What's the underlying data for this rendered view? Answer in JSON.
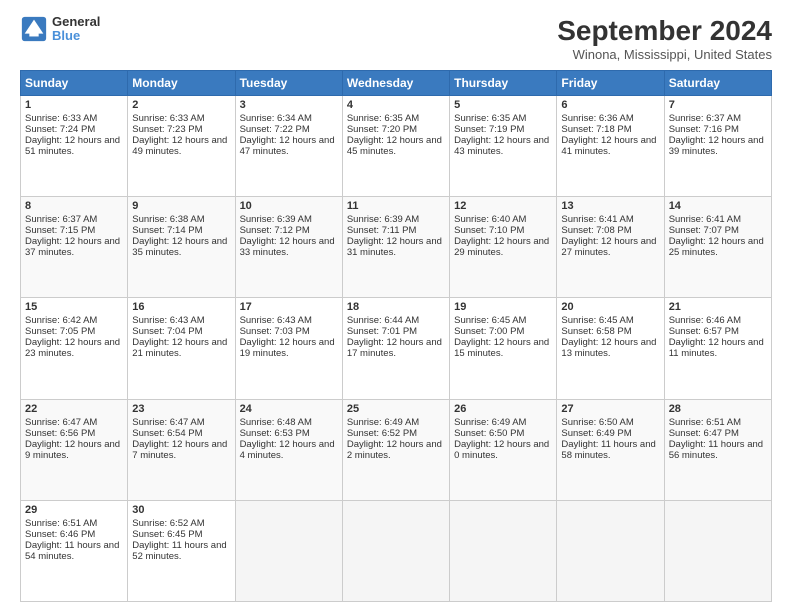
{
  "logo": {
    "line1": "General",
    "line2": "Blue"
  },
  "title": "September 2024",
  "location": "Winona, Mississippi, United States",
  "days_of_week": [
    "Sunday",
    "Monday",
    "Tuesday",
    "Wednesday",
    "Thursday",
    "Friday",
    "Saturday"
  ],
  "weeks": [
    [
      {
        "day": 1,
        "sunrise": "6:33 AM",
        "sunset": "7:24 PM",
        "daylight": "12 hours and 51 minutes."
      },
      {
        "day": 2,
        "sunrise": "6:33 AM",
        "sunset": "7:23 PM",
        "daylight": "12 hours and 49 minutes."
      },
      {
        "day": 3,
        "sunrise": "6:34 AM",
        "sunset": "7:22 PM",
        "daylight": "12 hours and 47 minutes."
      },
      {
        "day": 4,
        "sunrise": "6:35 AM",
        "sunset": "7:20 PM",
        "daylight": "12 hours and 45 minutes."
      },
      {
        "day": 5,
        "sunrise": "6:35 AM",
        "sunset": "7:19 PM",
        "daylight": "12 hours and 43 minutes."
      },
      {
        "day": 6,
        "sunrise": "6:36 AM",
        "sunset": "7:18 PM",
        "daylight": "12 hours and 41 minutes."
      },
      {
        "day": 7,
        "sunrise": "6:37 AM",
        "sunset": "7:16 PM",
        "daylight": "12 hours and 39 minutes."
      }
    ],
    [
      {
        "day": 8,
        "sunrise": "6:37 AM",
        "sunset": "7:15 PM",
        "daylight": "12 hours and 37 minutes."
      },
      {
        "day": 9,
        "sunrise": "6:38 AM",
        "sunset": "7:14 PM",
        "daylight": "12 hours and 35 minutes."
      },
      {
        "day": 10,
        "sunrise": "6:39 AM",
        "sunset": "7:12 PM",
        "daylight": "12 hours and 33 minutes."
      },
      {
        "day": 11,
        "sunrise": "6:39 AM",
        "sunset": "7:11 PM",
        "daylight": "12 hours and 31 minutes."
      },
      {
        "day": 12,
        "sunrise": "6:40 AM",
        "sunset": "7:10 PM",
        "daylight": "12 hours and 29 minutes."
      },
      {
        "day": 13,
        "sunrise": "6:41 AM",
        "sunset": "7:08 PM",
        "daylight": "12 hours and 27 minutes."
      },
      {
        "day": 14,
        "sunrise": "6:41 AM",
        "sunset": "7:07 PM",
        "daylight": "12 hours and 25 minutes."
      }
    ],
    [
      {
        "day": 15,
        "sunrise": "6:42 AM",
        "sunset": "7:05 PM",
        "daylight": "12 hours and 23 minutes."
      },
      {
        "day": 16,
        "sunrise": "6:43 AM",
        "sunset": "7:04 PM",
        "daylight": "12 hours and 21 minutes."
      },
      {
        "day": 17,
        "sunrise": "6:43 AM",
        "sunset": "7:03 PM",
        "daylight": "12 hours and 19 minutes."
      },
      {
        "day": 18,
        "sunrise": "6:44 AM",
        "sunset": "7:01 PM",
        "daylight": "12 hours and 17 minutes."
      },
      {
        "day": 19,
        "sunrise": "6:45 AM",
        "sunset": "7:00 PM",
        "daylight": "12 hours and 15 minutes."
      },
      {
        "day": 20,
        "sunrise": "6:45 AM",
        "sunset": "6:58 PM",
        "daylight": "12 hours and 13 minutes."
      },
      {
        "day": 21,
        "sunrise": "6:46 AM",
        "sunset": "6:57 PM",
        "daylight": "12 hours and 11 minutes."
      }
    ],
    [
      {
        "day": 22,
        "sunrise": "6:47 AM",
        "sunset": "6:56 PM",
        "daylight": "12 hours and 9 minutes."
      },
      {
        "day": 23,
        "sunrise": "6:47 AM",
        "sunset": "6:54 PM",
        "daylight": "12 hours and 7 minutes."
      },
      {
        "day": 24,
        "sunrise": "6:48 AM",
        "sunset": "6:53 PM",
        "daylight": "12 hours and 4 minutes."
      },
      {
        "day": 25,
        "sunrise": "6:49 AM",
        "sunset": "6:52 PM",
        "daylight": "12 hours and 2 minutes."
      },
      {
        "day": 26,
        "sunrise": "6:49 AM",
        "sunset": "6:50 PM",
        "daylight": "12 hours and 0 minutes."
      },
      {
        "day": 27,
        "sunrise": "6:50 AM",
        "sunset": "6:49 PM",
        "daylight": "11 hours and 58 minutes."
      },
      {
        "day": 28,
        "sunrise": "6:51 AM",
        "sunset": "6:47 PM",
        "daylight": "11 hours and 56 minutes."
      }
    ],
    [
      {
        "day": 29,
        "sunrise": "6:51 AM",
        "sunset": "6:46 PM",
        "daylight": "11 hours and 54 minutes."
      },
      {
        "day": 30,
        "sunrise": "6:52 AM",
        "sunset": "6:45 PM",
        "daylight": "11 hours and 52 minutes."
      },
      null,
      null,
      null,
      null,
      null
    ]
  ]
}
